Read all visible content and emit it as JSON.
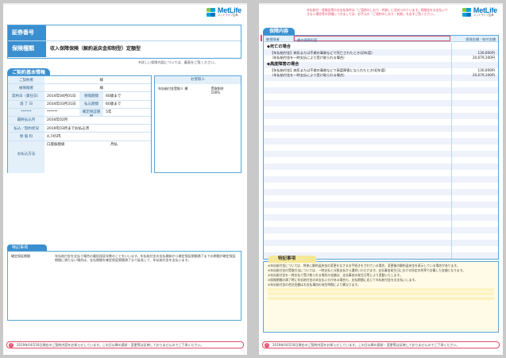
{
  "left_page": {
    "logo": {
      "brand": "MetLife",
      "sub": "メットライフ生命"
    },
    "header": {
      "policy_number_label": "証券番号",
      "policy_number_value": "",
      "insurance_type_label": "保険種類",
      "insurance_type_value": "収入保障保険（解約返戻金抑制型）定額型"
    },
    "header_note": "※詳しい保障内容については、裏面をご覧ください。",
    "contract_section": {
      "title": "ご契約基本情報",
      "policyholder_label": "ご契約者",
      "policyholder_value": "様",
      "insured_label": "被保険者",
      "insured_value": "様",
      "contract_date_label": "契約日（責任日）",
      "contract_date_value": "2014年04月01日",
      "coverage_period_label": "保険期間",
      "coverage_period_value": "60歳まで",
      "expiry_label": "満 了 日",
      "expiry_value": "2034年03月31日",
      "payment_period_label": "払込期間",
      "payment_period_value": "60歳まで",
      "masked_label": "******",
      "masked_value": "******",
      "guarantee_period_label": "確定保証期間",
      "guarantee_period_value": "5年",
      "last_payment_month_label": "最終払込月",
      "last_payment_month_value": "2034年02月",
      "payment_status_label": "払込／契約状況",
      "payment_status_value": "2019年03月までお払込済",
      "premium_label": "保 険 料",
      "premium_value": "4,745円",
      "payment_method_label": "お払込方法",
      "payment_method_value": "口座振替扱",
      "payment_freq_value": "月払"
    },
    "beneficiary": {
      "title": "お受取人",
      "col1": "年払給付金受取人",
      "col2": "様",
      "col3": "受取割合",
      "col3_value": "100%"
    },
    "contact_box": {
      "title": "特記事項",
      "row_label": "確定保証期間",
      "row_text": "年払給付金を支払う場合の最低保証年数のことをいいます。年払給付金の支払開始から確定保証期間満了までの期間が確定保証期間に満たない場合は、支払期間を確定保証期間満了まで延長して、年払給付金を支払います。"
    },
    "footer": "2019年04月18日現在のご契約内容をお知らせしています。この日以降の請求・変更等は反映しておりませんのでご了承ください。"
  },
  "right_page": {
    "logo": {
      "brand": "MetLife",
      "sub": "メットライフ生命"
    },
    "top_note": "年払給付・保険金等のお支払条件は「ご契約のしおり・約款」に定められています。保険金をお支払いできない場合等の詳細につきましては、お手元の「ご契約のしおり・約款」を必ずご覧ください。",
    "section_title": "保障内容",
    "table_head": {
      "col1": "被保険者",
      "col2": "様の保障内容",
      "col3": "保険金額／給付金額"
    },
    "cases": [
      {
        "title": "◆死亡の場合",
        "lines": [
          {
            "desc": "【年払給付金】病気または不慮の事故などで死亡されたとき(初年度)",
            "amount": "130,000円"
          },
          {
            "desc": "（年払給付金を一時支払により受け取られる場合）",
            "amount": "20,679,100円"
          }
        ]
      },
      {
        "title": "◆高度障害の場合",
        "lines": [
          {
            "desc": "【年払給付金】病気または不慮の事故などで高度障害になられたとき(初年度)",
            "amount": "130,000円"
          },
          {
            "desc": "（年払給付金を一時支払により受け取られる場合）",
            "amount": "20,679,100円"
          }
        ]
      }
    ],
    "special_notes": {
      "title": "特記事項",
      "items": [
        "※年払給付金については、将来に解約返戻金の変更をなさるお手続きをされている場合、変更後の解約返戻金を表示している場合があります。",
        "※年払給付金の受取方法については、一時支払と分割支払から選択いただけます。支払事由発生日における所定の利率で計算した金額となります。",
        "※年払給付金を一時支払で受け取られる場合の金額は、支払事由の発生日等により変動いたします。",
        "※保険期間の満了時に年払給付金の未支払い分がある場合も、支払期間に応じて年払給付金をお支払いします。",
        "※年払給付金の合計金額はお支払事由の発生時期により異なります。"
      ]
    },
    "footer": "2019年04月18日現在のご契約内容をお知らせしています。この日以降の請求・変更等は反映しておりませんのでご了承ください。"
  }
}
